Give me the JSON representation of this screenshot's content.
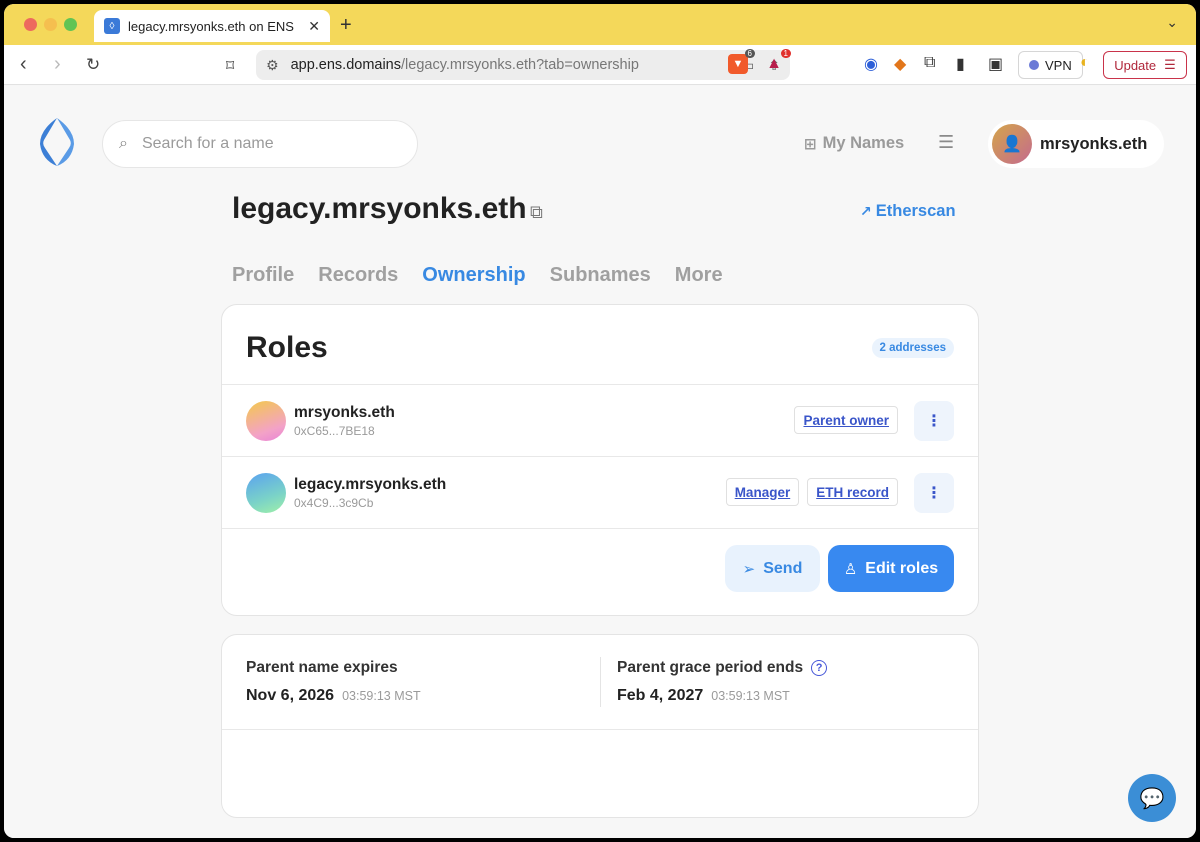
{
  "browser": {
    "tab_title": "legacy.mrsyonks.eth on ENS",
    "tab_close": "✕",
    "new_tab": "+",
    "url_host": "app.ens.domains",
    "url_path": "/legacy.mrsyonks.eth?tab=ownership",
    "brave_shield_count": "6",
    "rewards_count": "1",
    "vpn_label": "VPN",
    "update_label": "Update"
  },
  "header": {
    "search_placeholder": "Search for a name",
    "my_names_label": "My Names",
    "profile_name": "mrsyonks.eth"
  },
  "name": {
    "title": "legacy.mrsyonks.eth",
    "etherscan_label": "Etherscan"
  },
  "tabs": [
    {
      "label": "Profile",
      "active": false
    },
    {
      "label": "Records",
      "active": false
    },
    {
      "label": "Ownership",
      "active": true
    },
    {
      "label": "Subnames",
      "active": false
    },
    {
      "label": "More",
      "active": false
    }
  ],
  "roles": {
    "title": "Roles",
    "address_count": "2 addresses",
    "rows": [
      {
        "name": "mrsyonks.eth",
        "address": "0xC65...7BE18",
        "tags": [
          "Parent owner"
        ]
      },
      {
        "name": "legacy.mrsyonks.eth",
        "address": "0x4C9...3c9Cb",
        "tags": [
          "Manager",
          "ETH record"
        ]
      }
    ],
    "send_label": "Send",
    "edit_label": "Edit roles"
  },
  "expiry": {
    "parent_expires_label": "Parent name expires",
    "parent_expires_date": "Nov 6, 2026",
    "parent_expires_time": "03:59:13 MST",
    "grace_label": "Parent grace period ends",
    "grace_date": "Feb 4, 2027",
    "grace_time": "03:59:13 MST"
  },
  "colors": {
    "accent": "#3889e2",
    "tab_bar": "#f4d85a",
    "primary_button": "#3889f0"
  },
  "icons": [
    "search-icon",
    "grid-icon",
    "menu-icon",
    "copy-icon",
    "external-link-icon",
    "more-vertical-icon",
    "send-icon",
    "user-icon",
    "help-icon",
    "chat-icon"
  ]
}
